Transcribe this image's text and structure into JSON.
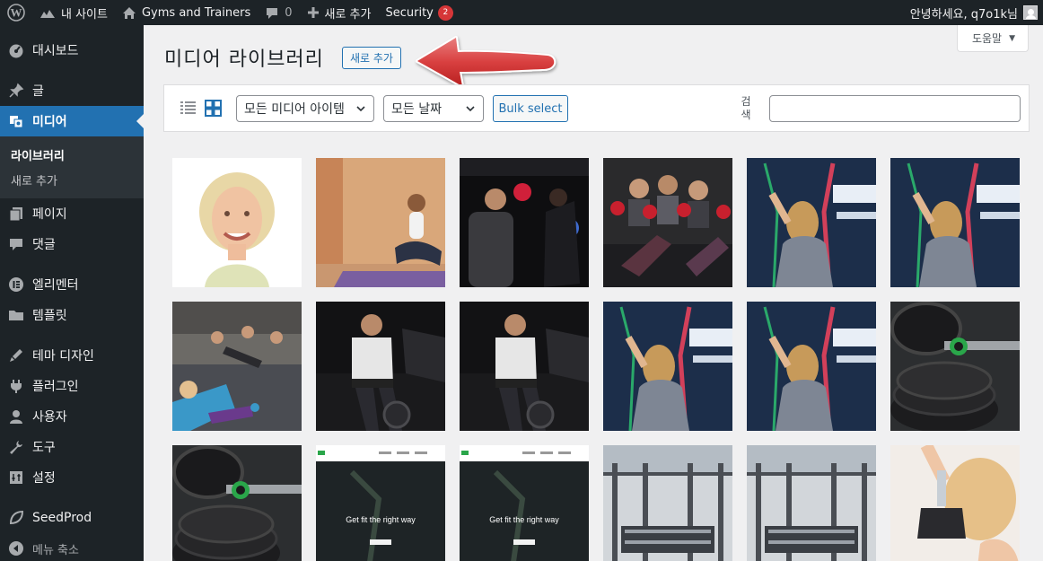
{
  "adminbar": {
    "site_name": "내 사이트",
    "site_link": "Gyms and Trainers",
    "comments_count": "0",
    "new_label": "새로 추가",
    "security_label": "Security",
    "security_badge": "2",
    "greeting": "안녕하세요, q7o1k님"
  },
  "sidebar": {
    "items": [
      {
        "label": "대시보드",
        "icon": "dashboard-icon"
      },
      {
        "label": "글",
        "icon": "pin-icon"
      },
      {
        "label": "미디어",
        "icon": "media-icon"
      },
      {
        "label": "페이지",
        "icon": "page-icon"
      },
      {
        "label": "댓글",
        "icon": "comment-icon"
      },
      {
        "label": "엘리멘터",
        "icon": "elementor-icon"
      },
      {
        "label": "템플릿",
        "icon": "folder-icon"
      },
      {
        "label": "테마 디자인",
        "icon": "theme-design-icon"
      },
      {
        "label": "플러그인",
        "icon": "plugin-icon"
      },
      {
        "label": "사용자",
        "icon": "user-icon"
      },
      {
        "label": "도구",
        "icon": "wrench-icon"
      },
      {
        "label": "설정",
        "icon": "settings-icon"
      },
      {
        "label": "SeedProd",
        "icon": "seedprod-icon"
      },
      {
        "label": "메뉴 축소",
        "icon": "collapse-icon"
      }
    ],
    "submenu": {
      "library": "라이브러리",
      "add_new": "새로 추가"
    }
  },
  "main": {
    "help_label": "도움말",
    "title": "미디어 라이브러리",
    "add_new_label": "새로 추가",
    "filters": {
      "type_selected": "모든 미디어 아이템",
      "date_selected": "모든 날짜",
      "bulk_label": "Bulk select",
      "search_label": "검색"
    },
    "overlay_text": "Get fit the right way"
  },
  "colors": {
    "adminbar_bg": "#1d2327",
    "accent": "#2271b1",
    "badge": "#d63638"
  }
}
